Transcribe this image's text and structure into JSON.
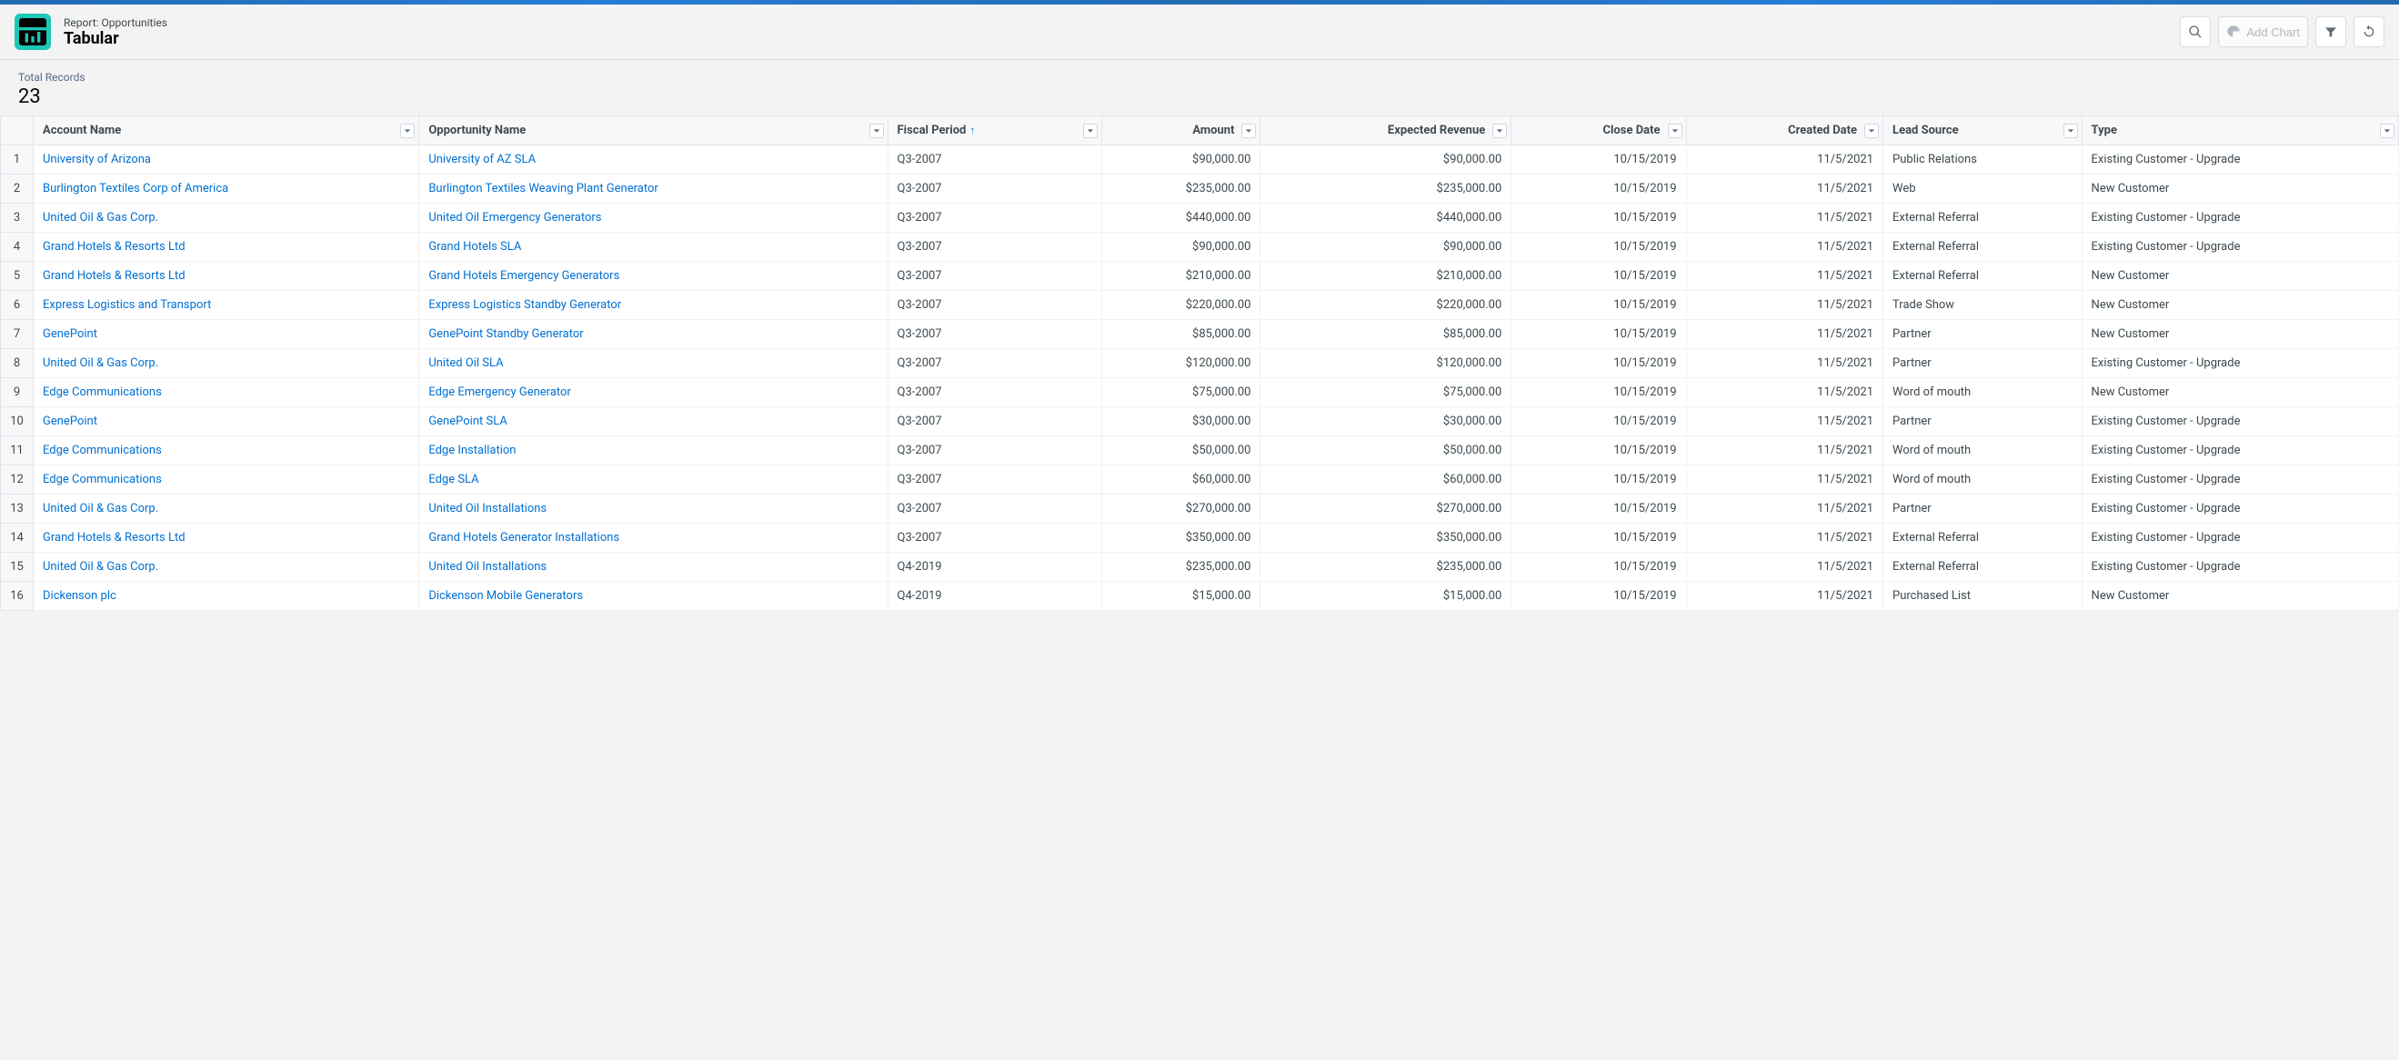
{
  "header": {
    "pre_title": "Report: Opportunities",
    "title": "Tabular",
    "add_chart_label": "Add Chart"
  },
  "summary": {
    "total_records_label": "Total Records",
    "total_records_value": "23"
  },
  "columns": [
    {
      "key": "account",
      "label": "Account Name",
      "sort": null,
      "align": "left",
      "link": true
    },
    {
      "key": "opportunity",
      "label": "Opportunity Name",
      "sort": null,
      "align": "left",
      "link": true
    },
    {
      "key": "fiscal",
      "label": "Fiscal Period",
      "sort": "asc",
      "align": "left",
      "link": false
    },
    {
      "key": "amount",
      "label": "Amount",
      "sort": null,
      "align": "right",
      "link": false
    },
    {
      "key": "expected",
      "label": "Expected Revenue",
      "sort": null,
      "align": "right",
      "link": false
    },
    {
      "key": "close",
      "label": "Close Date",
      "sort": null,
      "align": "right",
      "link": false
    },
    {
      "key": "created",
      "label": "Created Date",
      "sort": null,
      "align": "right",
      "link": false
    },
    {
      "key": "lead",
      "label": "Lead Source",
      "sort": null,
      "align": "left",
      "link": false
    },
    {
      "key": "type",
      "label": "Type",
      "sort": null,
      "align": "left",
      "link": false
    }
  ],
  "rows": [
    {
      "account": "University of Arizona",
      "opportunity": "University of AZ SLA",
      "fiscal": "Q3-2007",
      "amount": "$90,000.00",
      "expected": "$90,000.00",
      "close": "10/15/2019",
      "created": "11/5/2021",
      "lead": "Public Relations",
      "type": "Existing Customer - Upgrade"
    },
    {
      "account": "Burlington Textiles Corp of America",
      "opportunity": "Burlington Textiles Weaving Plant Generator",
      "fiscal": "Q3-2007",
      "amount": "$235,000.00",
      "expected": "$235,000.00",
      "close": "10/15/2019",
      "created": "11/5/2021",
      "lead": "Web",
      "type": "New Customer"
    },
    {
      "account": "United Oil & Gas Corp.",
      "opportunity": "United Oil Emergency Generators",
      "fiscal": "Q3-2007",
      "amount": "$440,000.00",
      "expected": "$440,000.00",
      "close": "10/15/2019",
      "created": "11/5/2021",
      "lead": "External Referral",
      "type": "Existing Customer - Upgrade"
    },
    {
      "account": "Grand Hotels & Resorts Ltd",
      "opportunity": "Grand Hotels SLA",
      "fiscal": "Q3-2007",
      "amount": "$90,000.00",
      "expected": "$90,000.00",
      "close": "10/15/2019",
      "created": "11/5/2021",
      "lead": "External Referral",
      "type": "Existing Customer - Upgrade"
    },
    {
      "account": "Grand Hotels & Resorts Ltd",
      "opportunity": "Grand Hotels Emergency Generators",
      "fiscal": "Q3-2007",
      "amount": "$210,000.00",
      "expected": "$210,000.00",
      "close": "10/15/2019",
      "created": "11/5/2021",
      "lead": "External Referral",
      "type": "New Customer"
    },
    {
      "account": "Express Logistics and Transport",
      "opportunity": "Express Logistics Standby Generator",
      "fiscal": "Q3-2007",
      "amount": "$220,000.00",
      "expected": "$220,000.00",
      "close": "10/15/2019",
      "created": "11/5/2021",
      "lead": "Trade Show",
      "type": "New Customer"
    },
    {
      "account": "GenePoint",
      "opportunity": "GenePoint Standby Generator",
      "fiscal": "Q3-2007",
      "amount": "$85,000.00",
      "expected": "$85,000.00",
      "close": "10/15/2019",
      "created": "11/5/2021",
      "lead": "Partner",
      "type": "New Customer"
    },
    {
      "account": "United Oil & Gas Corp.",
      "opportunity": "United Oil SLA",
      "fiscal": "Q3-2007",
      "amount": "$120,000.00",
      "expected": "$120,000.00",
      "close": "10/15/2019",
      "created": "11/5/2021",
      "lead": "Partner",
      "type": "Existing Customer - Upgrade"
    },
    {
      "account": "Edge Communications",
      "opportunity": "Edge Emergency Generator",
      "fiscal": "Q3-2007",
      "amount": "$75,000.00",
      "expected": "$75,000.00",
      "close": "10/15/2019",
      "created": "11/5/2021",
      "lead": "Word of mouth",
      "type": "New Customer"
    },
    {
      "account": "GenePoint",
      "opportunity": "GenePoint SLA",
      "fiscal": "Q3-2007",
      "amount": "$30,000.00",
      "expected": "$30,000.00",
      "close": "10/15/2019",
      "created": "11/5/2021",
      "lead": "Partner",
      "type": "Existing Customer - Upgrade"
    },
    {
      "account": "Edge Communications",
      "opportunity": "Edge Installation",
      "fiscal": "Q3-2007",
      "amount": "$50,000.00",
      "expected": "$50,000.00",
      "close": "10/15/2019",
      "created": "11/5/2021",
      "lead": "Word of mouth",
      "type": "Existing Customer - Upgrade"
    },
    {
      "account": "Edge Communications",
      "opportunity": "Edge SLA",
      "fiscal": "Q3-2007",
      "amount": "$60,000.00",
      "expected": "$60,000.00",
      "close": "10/15/2019",
      "created": "11/5/2021",
      "lead": "Word of mouth",
      "type": "Existing Customer - Upgrade"
    },
    {
      "account": "United Oil & Gas Corp.",
      "opportunity": "United Oil Installations",
      "fiscal": "Q3-2007",
      "amount": "$270,000.00",
      "expected": "$270,000.00",
      "close": "10/15/2019",
      "created": "11/5/2021",
      "lead": "Partner",
      "type": "Existing Customer - Upgrade"
    },
    {
      "account": "Grand Hotels & Resorts Ltd",
      "opportunity": "Grand Hotels Generator Installations",
      "fiscal": "Q3-2007",
      "amount": "$350,000.00",
      "expected": "$350,000.00",
      "close": "10/15/2019",
      "created": "11/5/2021",
      "lead": "External Referral",
      "type": "Existing Customer - Upgrade"
    },
    {
      "account": "United Oil & Gas Corp.",
      "opportunity": "United Oil Installations",
      "fiscal": "Q4-2019",
      "amount": "$235,000.00",
      "expected": "$235,000.00",
      "close": "10/15/2019",
      "created": "11/5/2021",
      "lead": "External Referral",
      "type": "Existing Customer - Upgrade"
    },
    {
      "account": "Dickenson plc",
      "opportunity": "Dickenson Mobile Generators",
      "fiscal": "Q4-2019",
      "amount": "$15,000.00",
      "expected": "$15,000.00",
      "close": "10/15/2019",
      "created": "11/5/2021",
      "lead": "Purchased List",
      "type": "New Customer"
    }
  ]
}
